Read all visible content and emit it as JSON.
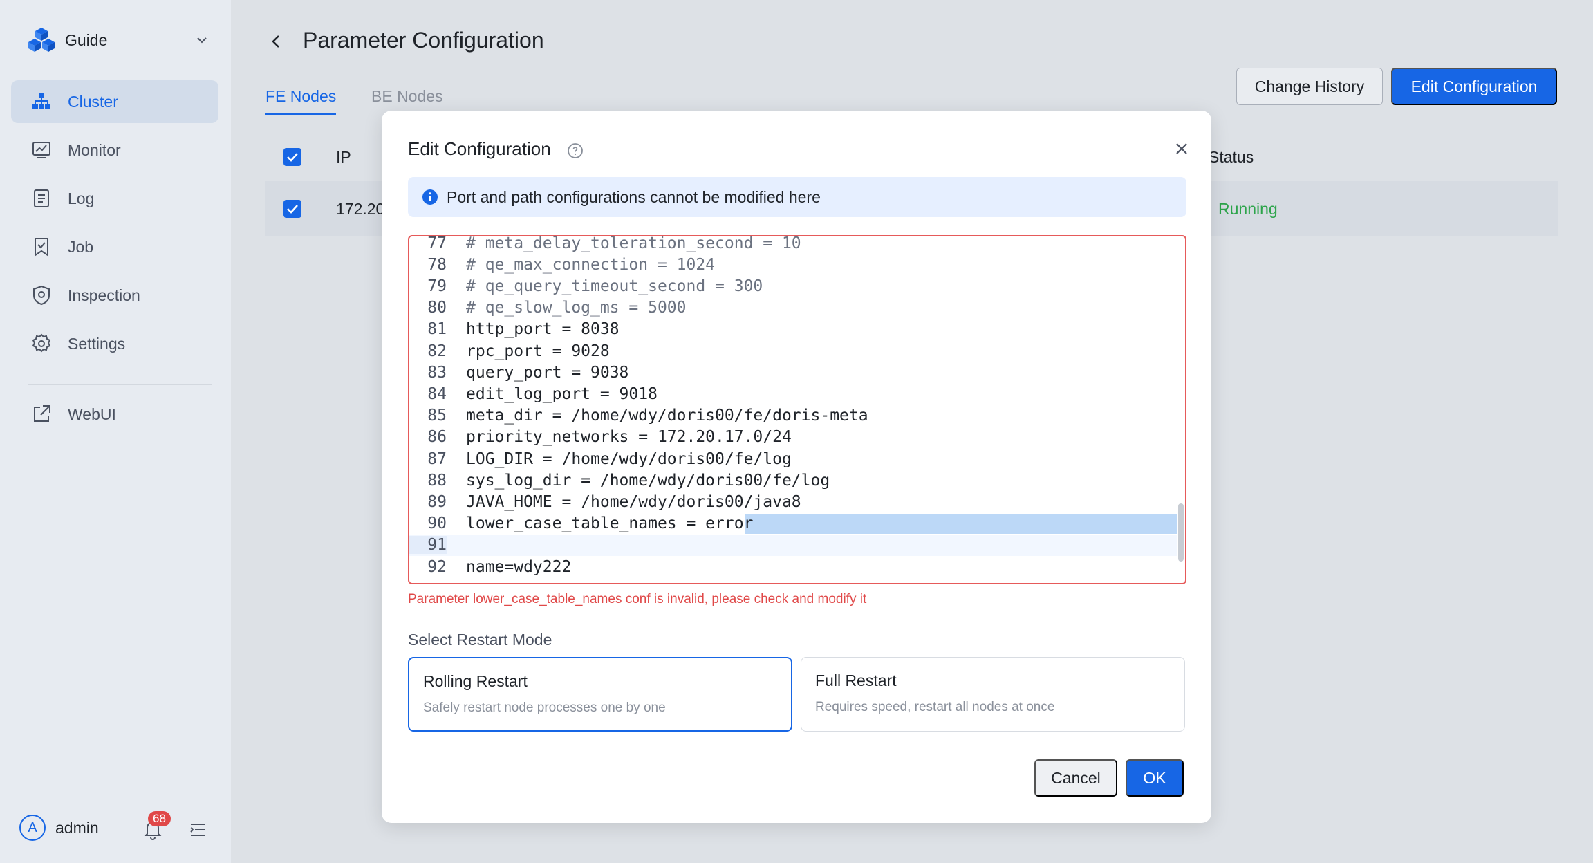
{
  "sidebar": {
    "brand": "Guide",
    "items": [
      {
        "label": "Cluster",
        "icon": "cluster-icon"
      },
      {
        "label": "Monitor",
        "icon": "monitor-icon"
      },
      {
        "label": "Log",
        "icon": "log-icon"
      },
      {
        "label": "Job",
        "icon": "job-icon"
      },
      {
        "label": "Inspection",
        "icon": "inspection-icon"
      },
      {
        "label": "Settings",
        "icon": "gear-icon"
      },
      {
        "label": "WebUI",
        "icon": "external-link-icon"
      }
    ],
    "active": "Cluster",
    "user": {
      "initial": "A",
      "name": "admin"
    },
    "notifications": "68"
  },
  "page": {
    "title": "Parameter Configuration",
    "tabs": [
      {
        "label": "FE Nodes"
      },
      {
        "label": "BE Nodes"
      }
    ],
    "active_tab": "FE Nodes",
    "buttons": {
      "history": "Change History",
      "edit": "Edit Configuration"
    },
    "table": {
      "headers": {
        "ip": "IP",
        "status": "Status"
      },
      "rows": [
        {
          "ip": "172.20",
          "status": "Running"
        }
      ]
    }
  },
  "modal": {
    "title": "Edit Configuration",
    "alert": "Port and path configurations cannot be modified here",
    "code_lines": [
      {
        "n": "77",
        "text": "# meta_delay_toleration_second = 10",
        "comment": true
      },
      {
        "n": "78",
        "text": "# qe_max_connection = 1024",
        "comment": true
      },
      {
        "n": "79",
        "text": "# qe_query_timeout_second = 300",
        "comment": true
      },
      {
        "n": "80",
        "text": "# qe_slow_log_ms = 5000",
        "comment": true
      },
      {
        "n": "81",
        "text": "http_port = 8038"
      },
      {
        "n": "82",
        "text": "rpc_port = 9028"
      },
      {
        "n": "83",
        "text": "query_port = 9038"
      },
      {
        "n": "84",
        "text": "edit_log_port = 9018"
      },
      {
        "n": "85",
        "text": "meta_dir = /home/wdy/doris00/fe/doris-meta"
      },
      {
        "n": "86",
        "text": "priority_networks = 172.20.17.0/24"
      },
      {
        "n": "87",
        "text": "LOG_DIR = /home/wdy/doris00/fe/log"
      },
      {
        "n": "88",
        "text": "sys_log_dir = /home/wdy/doris00/fe/log"
      },
      {
        "n": "89",
        "text": "JAVA_HOME = /home/wdy/doris00/java8"
      },
      {
        "n": "90",
        "text": "lower_case_table_names = error"
      },
      {
        "n": "91",
        "text": "",
        "current": true
      },
      {
        "n": "92",
        "text": "name=wdy222"
      }
    ],
    "error": "Parameter lower_case_table_names conf is invalid, please check and modify it",
    "restart_label": "Select Restart Mode",
    "restart_options": [
      {
        "title": "Rolling Restart",
        "desc": "Safely restart node processes one by one",
        "selected": true
      },
      {
        "title": "Full Restart",
        "desc": "Requires speed, restart all nodes at once",
        "selected": false
      }
    ],
    "cancel": "Cancel",
    "ok": "OK"
  },
  "colors": {
    "accent": "#1766e5",
    "error": "#e04848",
    "success": "#2ca44a"
  }
}
